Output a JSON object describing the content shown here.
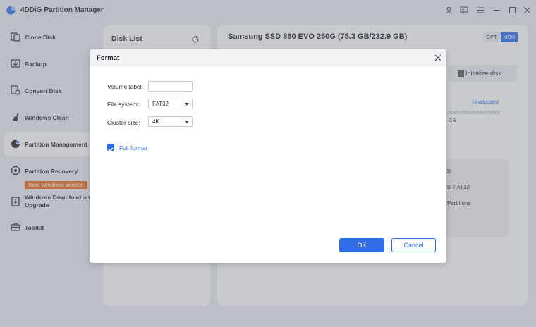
{
  "app": {
    "title": "4DDiG Partition Manager"
  },
  "sidebar": {
    "items": [
      {
        "label": "Clone Disk",
        "icon": "clone-disk-icon"
      },
      {
        "label": "Backup",
        "icon": "backup-icon"
      },
      {
        "label": "Convert Disk",
        "icon": "convert-disk-icon"
      },
      {
        "label": "Windows Clean",
        "icon": "broom-icon"
      },
      {
        "label": "Partition Management",
        "icon": "pie-chart-icon"
      },
      {
        "label": "Partition Recovery",
        "icon": "recovery-icon"
      },
      {
        "label": "Windows Download and Upgrade",
        "icon": "windows-download-icon"
      },
      {
        "label": "Toolkit",
        "icon": "toolbox-icon"
      }
    ],
    "new_badge": "New Windows version"
  },
  "disk_list": {
    "title": "Disk List"
  },
  "main": {
    "disk_name": "Samsung SSD 860 EVO 250G (75.3 GB/232.9 GB)",
    "gpt_label": "GPT",
    "mbr_label": "MBR",
    "initialize_label": "Initialize disk",
    "unallocated_label": "Unallocated",
    "size_fragment": "GB",
    "ops": [
      "te",
      "to FAT32",
      "Partitions"
    ]
  },
  "dialog": {
    "title": "Format",
    "volume_label_label": "Volume label:",
    "volume_label_value": "",
    "file_system_label": "File system:",
    "file_system_value": "FAT32",
    "cluster_size_label": "Cluster size:",
    "cluster_size_value": "4K",
    "full_format_label": "Full format",
    "full_format_checked": true,
    "ok_label": "OK",
    "cancel_label": "Cancel"
  },
  "colors": {
    "accent": "#2f6ee6",
    "badge": "#f07020"
  }
}
